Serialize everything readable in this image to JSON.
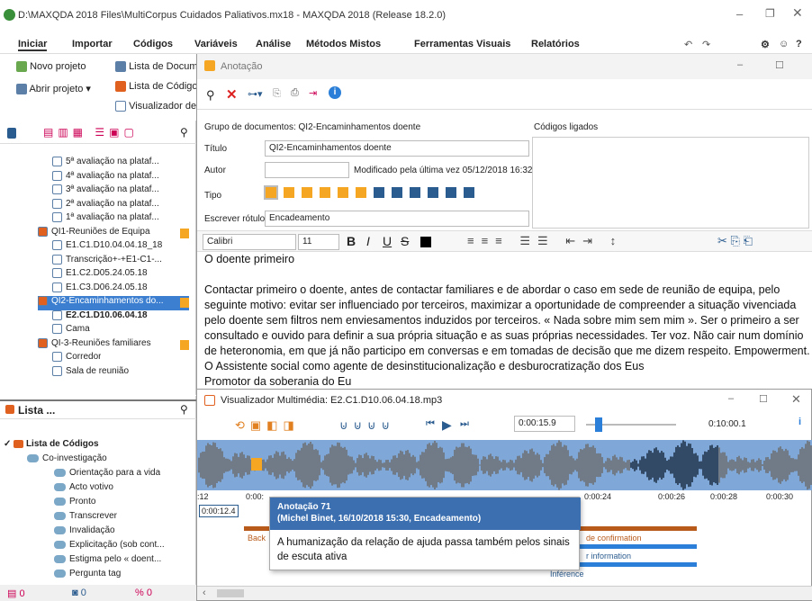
{
  "window": {
    "title": "D:\\MAXQDA 2018 Files\\MultiCorpus Cuidados Paliativos.mx18 - MAXQDA 2018 (Release 18.2.0)"
  },
  "menu": [
    "Iniciar",
    "Importar",
    "Códigos",
    "Variáveis",
    "Análise",
    "Métodos Mistos",
    "Ferramentas Visuais",
    "Relatórios"
  ],
  "ribbon": {
    "new_project": "Novo projeto",
    "open_project": "Abrir projeto",
    "doc_list": "Lista de Docum",
    "code_list": "Lista de Código",
    "viewer": "Visualizador de"
  },
  "doc_tree": [
    {
      "label": "5ª avaliação na plataf...",
      "indent": 58
    },
    {
      "label": "4ª avaliação na plataf...",
      "indent": 58
    },
    {
      "label": "3ª avaliação na plataf...",
      "indent": 58
    },
    {
      "label": "2ª avaliação na plataf...",
      "indent": 58
    },
    {
      "label": "1ª avaliação na plataf...",
      "indent": 58
    },
    {
      "label": "QI1-Reuniões de Equipa",
      "indent": 42
    },
    {
      "label": "E1.C1.D10.04.04.18_18",
      "indent": 58
    },
    {
      "label": "Transcrição+-+E1-C1-...",
      "indent": 58
    },
    {
      "label": "E1.C2.D05.24.05.18",
      "indent": 58
    },
    {
      "label": "E1.C3.D06.24.05.18",
      "indent": 58
    },
    {
      "label": "QI2-Encaminhamentos do...",
      "indent": 42
    },
    {
      "label": "E2.C1.D10.06.04.18",
      "indent": 58
    },
    {
      "label": "Cama",
      "indent": 58
    },
    {
      "label": "QI-3-Reuniões familiares",
      "indent": 42
    },
    {
      "label": "Corredor",
      "indent": 58
    },
    {
      "label": "Sala de reunião",
      "indent": 58
    }
  ],
  "code_panel": {
    "title": "Lista ...",
    "root": "Lista de Códigos",
    "items": [
      "Co-investigação",
      "Orientação para a vida",
      "Acto votivo",
      "Pronto",
      "Transcrever",
      "Invalidação",
      "Explicitação (sob cont...",
      "Estigma pelo « doent...",
      "Pergunta tag"
    ]
  },
  "status": {
    "a": "0",
    "b": "0",
    "c": "0"
  },
  "annotation": {
    "window_title": "Anotação",
    "doc_group": "Grupo de documentos: QI2-Encaminhamentos doente",
    "linked_codes": "Códigos ligados",
    "title_label": "Título",
    "title_value": "QI2-Encaminhamentos doente",
    "author_label": "Autor",
    "modified": "Modificado pela última vez  05/12/2018 16:32",
    "type_label": "Tipo",
    "write_label": "Escrever rótulo",
    "write_value": "Encadeamento",
    "font": "Calibri",
    "size": "11",
    "text1": "O doente primeiro",
    "text2": "Contactar primeiro o doente, antes de contactar familiares e de abordar o caso em sede de reunião de equipa, pelo seguinte motivo: evitar ser influenciado por terceiros, maximizar a oportunidade de compreender a situação vivenciada pelo doente sem filtros nem enviesamentos induzidos por terceiros. « Nada sobre mim sem mim ». Ser o primeiro a ser consultado e ouvido para definir a sua própria situação e as suas próprias necessidades. Ter voz. Não cair num domínio de heteronomia, em que já não participo em conversas e em tomadas de decisão que me dizem respeito. Empowerment.",
    "text3": "O Assistente social como agente de desinstitucionalização e desburocratização dos Eus",
    "text4": "Promotor da soberania do Eu"
  },
  "media": {
    "title": "Visualizador Multimédia:  E2.C1.D10.06.04.18.mp3",
    "time": "0:00:15.9",
    "total": "0:10:00.1",
    "cursor": "0:00:12.4",
    "ticks": [
      ":12",
      "0:00:",
      "0:00:24",
      "0:00:26",
      "0:00:28",
      "0:00:30"
    ],
    "seg1": "Back",
    "seg2": "de confirmation",
    "seg3": "r information",
    "seg4": "Inférence"
  },
  "tooltip": {
    "head1": "Anotação 71",
    "head2": "(Michel Binet, 16/10/2018 15:30, Encadeamento)",
    "body": "A humanização da relação de ajuda passa também pelos sinais de escuta ativa"
  },
  "colors": {
    "accent": "#f5a623",
    "doc_icon": "#5b7fa6",
    "media_wave": "#6c6c6c",
    "tip_head": "#3c6fb0"
  }
}
